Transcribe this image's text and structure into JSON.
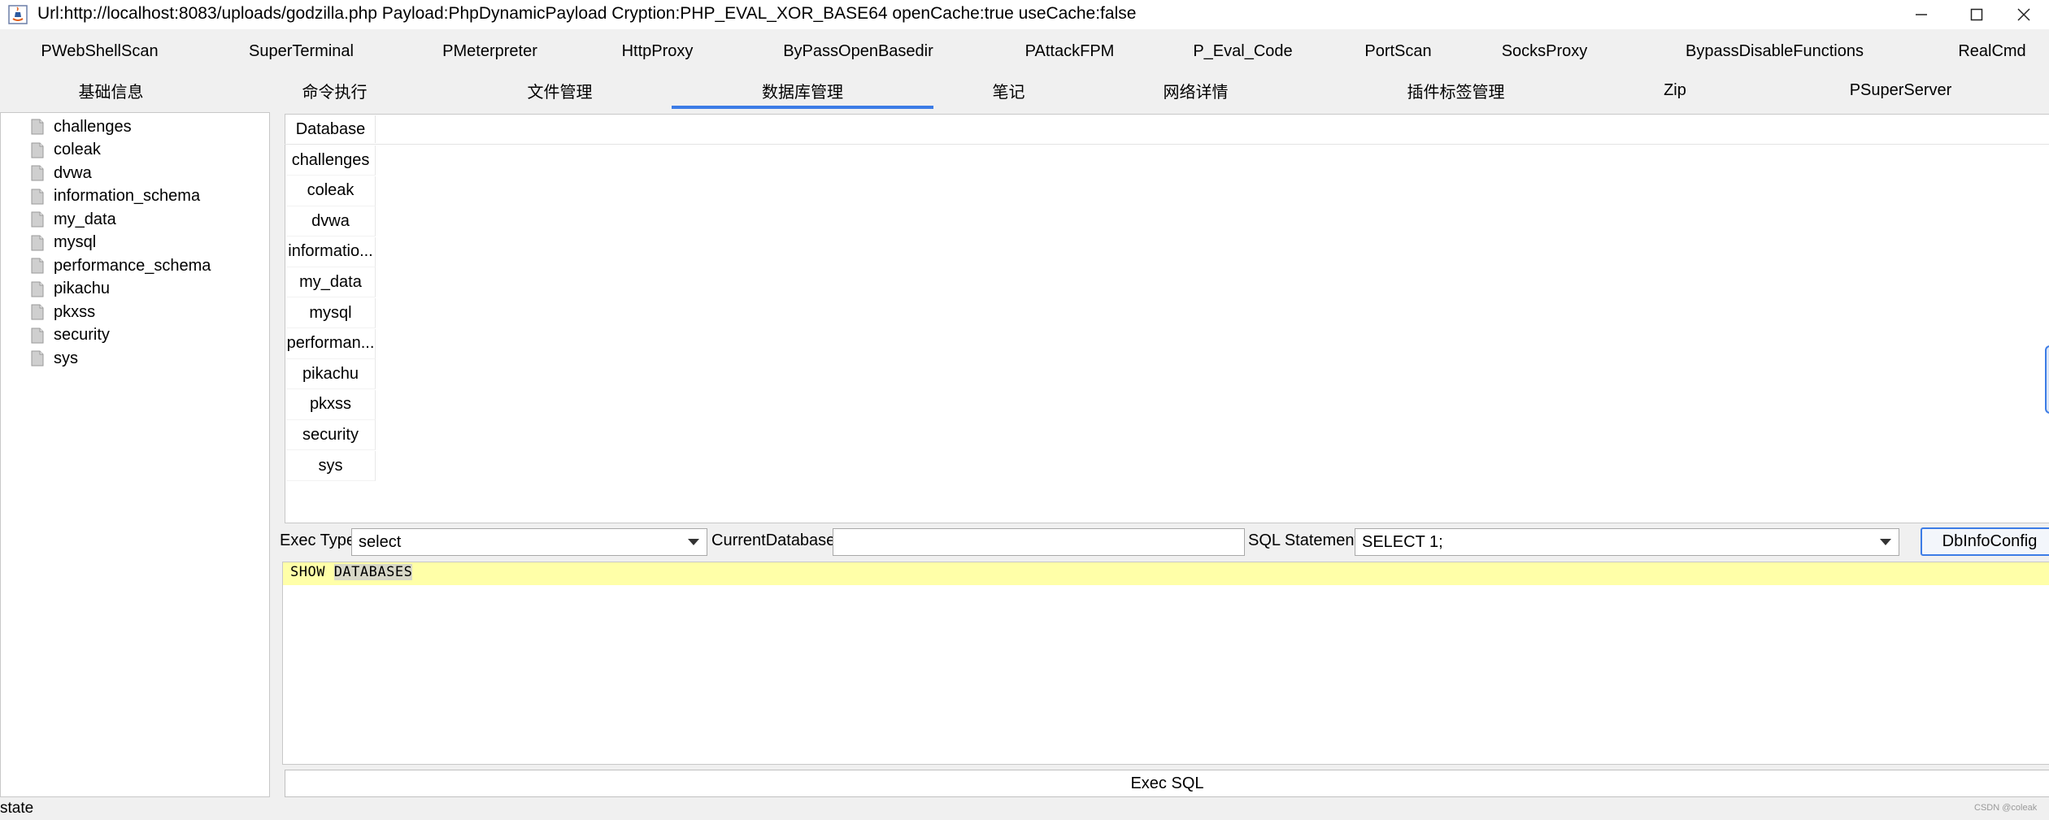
{
  "window": {
    "title": "Url:http://localhost:8083/uploads/godzilla.php Payload:PhpDynamicPayload Cryption:PHP_EVAL_XOR_BASE64 openCache:true useCache:false",
    "minimize_icon": "minimize-icon",
    "maximize_icon": "maximize-icon",
    "close_icon": "close-icon"
  },
  "plugin_tabs": [
    "PWebShellScan",
    "SuperTerminal",
    "PMeterpreter",
    "HttpProxy",
    "ByPassOpenBasedir",
    "PAttackFPM",
    "P_Eval_Code",
    "PortScan",
    "SocksProxy",
    "BypassDisableFunctions",
    "RealCmd"
  ],
  "main_tabs": [
    "基础信息",
    "命令执行",
    "文件管理",
    "数据库管理",
    "笔记",
    "网络详情",
    "插件标签管理",
    "Zip",
    "PSuperServer"
  ],
  "active_main_tab": "数据库管理",
  "tree": {
    "items": [
      "challenges",
      "coleak",
      "dvwa",
      "information_schema",
      "my_data",
      "mysql",
      "performance_schema",
      "pikachu",
      "pkxss",
      "security",
      "sys"
    ],
    "item_icon": "file-icon"
  },
  "table": {
    "column": "Database",
    "rows": [
      "challenges",
      "coleak",
      "dvwa",
      "informatio...",
      "my_data",
      "mysql",
      "performan...",
      "pikachu",
      "pkxss",
      "security",
      "sys"
    ]
  },
  "exec_bar": {
    "exec_type_label": "Exec Type",
    "exec_type_value": "select",
    "current_database_label": "CurrentDatabase",
    "current_database_value": "",
    "sql_statement_label": "SQL Statement",
    "sql_statement_value": "SELECT 1;",
    "dbinfo_button": "DbInfoConfig"
  },
  "editor": {
    "prefix": "SHOW ",
    "selected": "DATABASES"
  },
  "exec_sql_button": "Exec SQL",
  "status": "state",
  "watermark": "CSDN @coleak",
  "colors": {
    "accent": "#3c7ce6",
    "editor_line_highlight": "#ffffa8",
    "background": "#f0f0f0"
  }
}
